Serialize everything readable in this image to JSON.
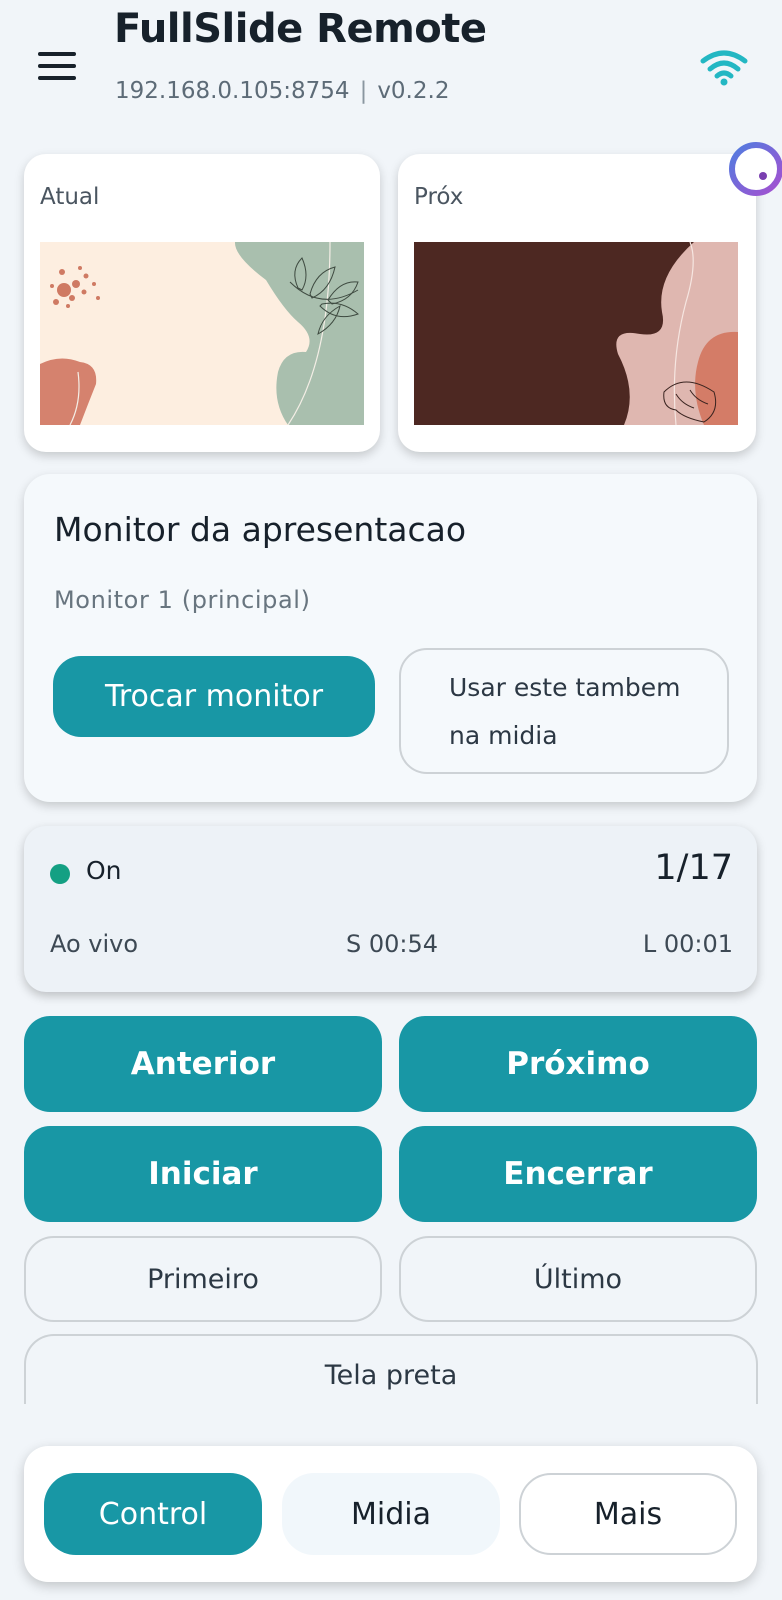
{
  "header": {
    "title": "FullSlide Remote",
    "address": "192.168.0.105:8754",
    "separator": "|",
    "version": "v0.2.2",
    "menu_icon": "hamburger-menu-icon",
    "connection_icon": "wifi-icon",
    "accent_color": "#1897a5"
  },
  "previews": {
    "current_label": "Atual",
    "next_label": "Próx"
  },
  "monitor": {
    "title": "Monitor da apresentacao",
    "current": "Monitor 1 (principal)",
    "swap_label": "Trocar monitor",
    "use_media_line1": "Usar este tambem",
    "use_media_line2": "na midia"
  },
  "status": {
    "state": "On",
    "state_color": "#14a083",
    "counter": "1/17",
    "mode": "Ao vivo",
    "slide_timer": "S 00:54",
    "live_timer": "L 00:01"
  },
  "controls": {
    "previous": "Anterior",
    "next": "Próximo",
    "start": "Iniciar",
    "end": "Encerrar",
    "first": "Primeiro",
    "last": "Último",
    "black_screen": "Tela preta"
  },
  "nav": {
    "tabs": [
      {
        "label": "Control",
        "active": true
      },
      {
        "label": "Midia",
        "active": false
      },
      {
        "label": "Mais",
        "active": false
      }
    ]
  }
}
